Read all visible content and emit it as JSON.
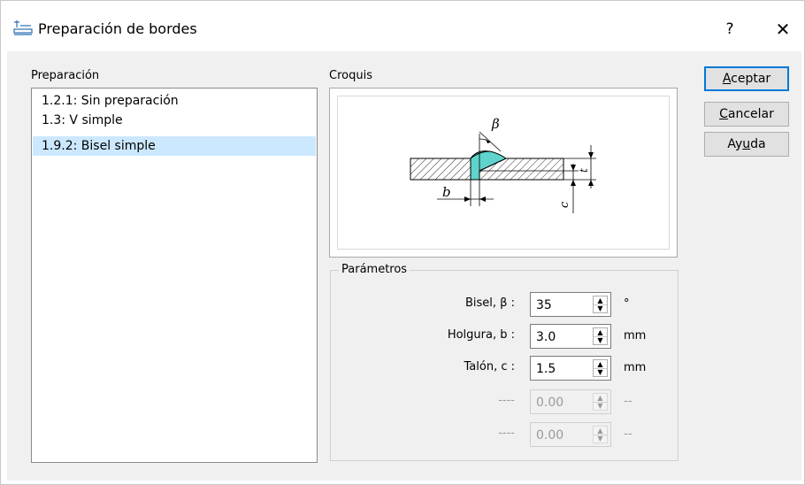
{
  "window": {
    "title": "Preparación de bordes",
    "help_label": "?",
    "close_label": "✕"
  },
  "preparation": {
    "label": "Preparación",
    "items": [
      {
        "label": "1.2.1: Sin preparación"
      },
      {
        "label": "1.3: V simple"
      },
      {
        "label": "1.9.2: Bisel simple"
      }
    ],
    "selected_index": 2
  },
  "sketch": {
    "label": "Croquis",
    "beta": "β",
    "b": "b",
    "t": "t",
    "c": "c",
    "fill_color": "#5fd3cc"
  },
  "parameters": {
    "label": "Parámetros",
    "rows": [
      {
        "label": "Bisel, β :",
        "value": "35",
        "unit": "°",
        "enabled": true
      },
      {
        "label": "Holgura, b :",
        "value": "3.0",
        "unit": "mm",
        "enabled": true
      },
      {
        "label": "Talón, c :",
        "value": "1.5",
        "unit": "mm",
        "enabled": true
      },
      {
        "label": "----",
        "value": "0.00",
        "unit": "--",
        "enabled": false
      },
      {
        "label": "----",
        "value": "0.00",
        "unit": "--",
        "enabled": false
      }
    ]
  },
  "buttons": {
    "accept": {
      "mnemonic": "A",
      "rest": "ceptar"
    },
    "cancel": {
      "mnemonic": "C",
      "rest": "ancelar"
    },
    "help": {
      "pre": "Ay",
      "mnemonic": "u",
      "rest": "da"
    }
  },
  "colors": {
    "accent": "#0078d7",
    "selection": "#cce8ff",
    "background": "#f0f0f0"
  }
}
